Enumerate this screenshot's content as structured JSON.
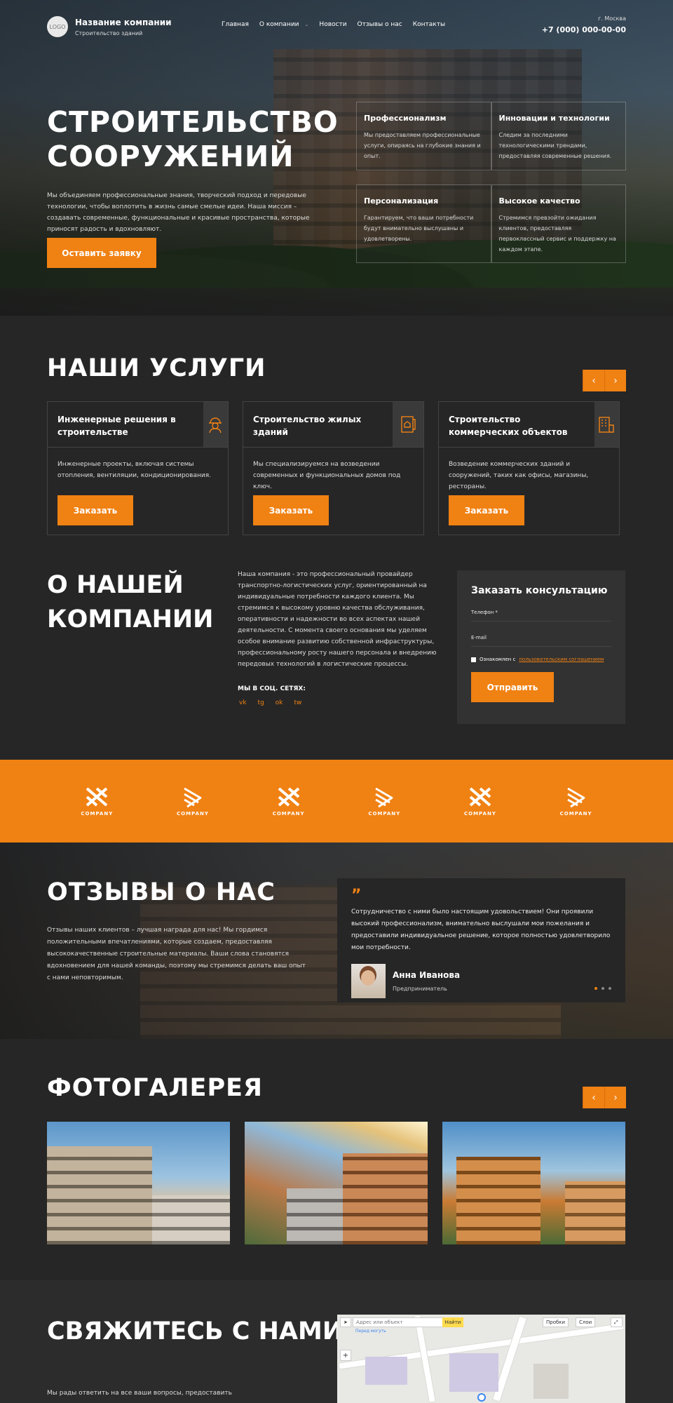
{
  "header": {
    "logo_text": "LOGO",
    "company_name": "Название компании",
    "company_tagline": "Строительство зданий",
    "nav": [
      "Главная",
      "О компании",
      "Новости",
      "Отзывы о нас",
      "Контакты"
    ],
    "city": "г. Москва",
    "phone": "+7 (000) 000-00-00"
  },
  "hero": {
    "title": "СТРОИТЕЛЬСТВО СООРУЖЕНИЙ",
    "description": "Мы объединяем профессиональные знания, творческий подход и передовые технологии, чтобы воплотить в жизнь самые смелые идеи. Наша миссия – создавать современные, функциональные и красивые пространства, которые приносят радость и вдохновляют.",
    "button": "Оставить заявку",
    "features": [
      {
        "title": "Профессионализм",
        "text": "Мы предоставляем профессиональные услуги, опираясь на глубокие знания и опыт."
      },
      {
        "title": "Инновации и технологии",
        "text": "Следим за последними технологическими трендами, предоставляя современные решения."
      },
      {
        "title": "Персонализация",
        "text": "Гарантируем, что ваши потребности будут внимательно выслушаны и удовлетворены."
      },
      {
        "title": "Высокое качество",
        "text": "Стремимся превзойти ожидания клиентов, предоставляя первоклассный сервис и поддержку на каждом этапе."
      }
    ]
  },
  "services": {
    "title": "НАШИ УСЛУГИ",
    "prev": "‹",
    "next": "›",
    "items": [
      {
        "title": "Инженерные решения в строительстве",
        "text": "Инженерные проекты, включая системы отопления, вентиляции, кондиционирования.",
        "button": "Заказать",
        "icon": "engineer-icon"
      },
      {
        "title": "Строительство жилых зданий",
        "text": "Мы специализируемся на возведении современных и функциональных домов под ключ.",
        "button": "Заказать",
        "icon": "house-plan-icon"
      },
      {
        "title": "Строительство коммерческих объектов",
        "text": "Возведение коммерческих зданий и сооружений, таких как офисы, магазины, рестораны.",
        "button": "Заказать",
        "icon": "office-building-icon"
      }
    ]
  },
  "about": {
    "title": "О НАШЕЙ КОМПАНИИ",
    "text": "Наша компания - это профессиональный провайдер транспортно-логистических услуг, ориентированный на индивидуальные потребности каждого клиента. Мы стремимся к высокому уровню качества обслуживания, оперативности и надежности во всех аспектах нашей деятельности. С момента своего основания мы уделяем особое внимание развитию собственной инфраструктуры, профессиональному росту нашего персонала и внедрению передовых технологий в логистические процессы.",
    "social_title": "МЫ В СОЦ. СЕТЯХ:",
    "social": [
      "vk",
      "tg",
      "ok",
      "tw"
    ]
  },
  "form": {
    "title": "Заказать консультацию",
    "phone_label": "Телефон *",
    "email_label": "E-mail",
    "agree_text": "Ознакомлен с",
    "agree_link": "пользовательским соглашением",
    "button": "Отправить"
  },
  "partners": {
    "label": "COMPANY"
  },
  "reviews": {
    "title": "ОТЗЫВЫ О НАС",
    "text": "Отзывы наших клиентов – лучшая награда для нас! Мы гордимся положительными впечатлениями, которые создаем, предоставляя высококачественные строительные материалы. Ваши слова становятся вдохновением для нашей команды, поэтому мы стремимся делать ваш опыт с нами неповторимым.",
    "quote_mark": "”",
    "review_text": "Сотрудничество с ними было настоящим удовольствием! Они проявили высокий профессионализм, внимательно выслушали мои пожелания и предоставили индивидуальное решение, которое полностью удовлетворило мои потребности.",
    "author": "Анна Иванова",
    "role": "Предприниматель"
  },
  "gallery": {
    "title": "ФОТОГАЛЕРЕЯ",
    "prev": "‹",
    "next": "›"
  },
  "contact": {
    "title": "СВЯЖИТЕСЬ С НАМИ",
    "text": "Мы рады ответить на все ваши вопросы, предоставить",
    "map": {
      "search_placeholder": "Адрес или объект",
      "find": "Найти",
      "traffic": "Пробки",
      "layers": "Слои",
      "hint": "Перед могуть"
    }
  },
  "colors": {
    "accent": "#f08113",
    "background": "#262626"
  }
}
